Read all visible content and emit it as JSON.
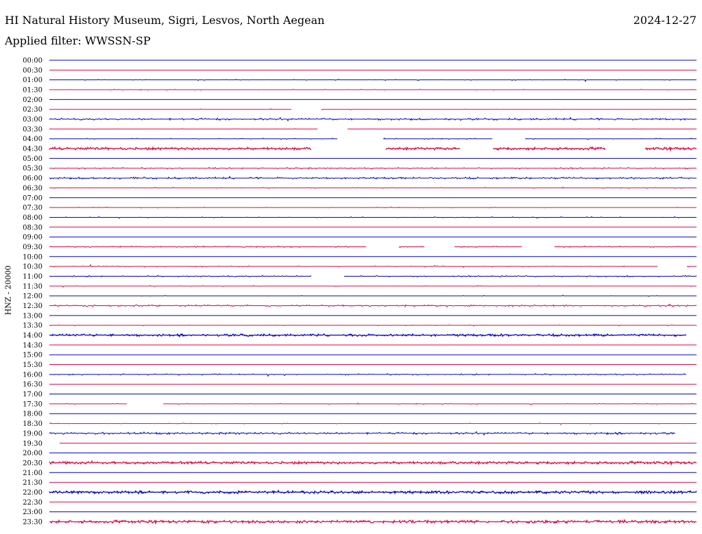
{
  "header": {
    "station": "HI Natural History Museum, Sigri, Lesvos, North Aegean",
    "date": "2024-12-27",
    "filter": "Applied filter: WWSSN-SP"
  },
  "chart_data": {
    "type": "line",
    "title": "HI Natural History Museum, Sigri, Lesvos, North Aegean",
    "subtitle": "Applied filter: WWSSN-SP",
    "ylabel": "HNZ - 20000",
    "colors": [
      "#0000cc",
      "#e8003c"
    ],
    "row_labels": [
      "00:00",
      "00:30",
      "01:00",
      "01:30",
      "02:00",
      "02:30",
      "03:00",
      "03:30",
      "04:00",
      "04:30",
      "05:00",
      "05:30",
      "06:00",
      "06:30",
      "07:00",
      "07:30",
      "08:00",
      "08:30",
      "09:00",
      "09:30",
      "10:00",
      "10:30",
      "11:00",
      "11:30",
      "12:00",
      "12:30",
      "13:00",
      "13:30",
      "14:00",
      "14:30",
      "15:00",
      "15:30",
      "16:00",
      "16:30",
      "17:00",
      "17:30",
      "18:00",
      "18:30",
      "19:00",
      "19:30",
      "20:00",
      "20:30",
      "21:00",
      "21:30",
      "22:00",
      "22:30",
      "23:00",
      "23:30"
    ],
    "activity": [
      0,
      0,
      0.08,
      0.06,
      0,
      0.05,
      0.55,
      0.05,
      0.15,
      0.85,
      0,
      0.35,
      0.5,
      0.1,
      0,
      0.05,
      0.12,
      0,
      0,
      0.3,
      0,
      0.15,
      0.3,
      0.05,
      0.03,
      0.45,
      0,
      0.05,
      0.7,
      0,
      0,
      0,
      0.3,
      0,
      0,
      0.1,
      0,
      0.05,
      0.6,
      0,
      0,
      0.85,
      0,
      0,
      0.9,
      0,
      0,
      0.9
    ],
    "gaps": [
      [],
      [],
      [],
      [],
      [],
      [
        [
          0.375,
          0.42
        ]
      ],
      [],
      [
        [
          0.415,
          0.46
        ]
      ],
      [
        [
          0.445,
          0.515
        ],
        [
          0.685,
          0.735
        ]
      ],
      [
        [
          0.405,
          0.52
        ],
        [
          0.635,
          0.685
        ],
        [
          0.86,
          0.92
        ]
      ],
      [],
      [],
      [],
      [],
      [],
      [],
      [],
      [],
      [],
      [
        [
          0.49,
          0.54
        ],
        [
          0.58,
          0.625
        ],
        [
          0.73,
          0.78
        ]
      ],
      [],
      [
        [
          0.94,
          0.985
        ]
      ],
      [
        [
          0.405,
          0.455
        ]
      ],
      [],
      [],
      [],
      [],
      [],
      [
        [
          0.985,
          1.0
        ]
      ],
      [],
      [],
      [],
      [
        [
          0.985,
          1.0
        ]
      ],
      [],
      [],
      [
        [
          0.12,
          0.175
        ]
      ],
      [],
      [],
      [
        [
          0.968,
          1.0
        ]
      ],
      [
        [
          0.0,
          0.015
        ]
      ],
      [],
      [],
      [],
      [],
      [],
      [],
      [],
      []
    ]
  }
}
